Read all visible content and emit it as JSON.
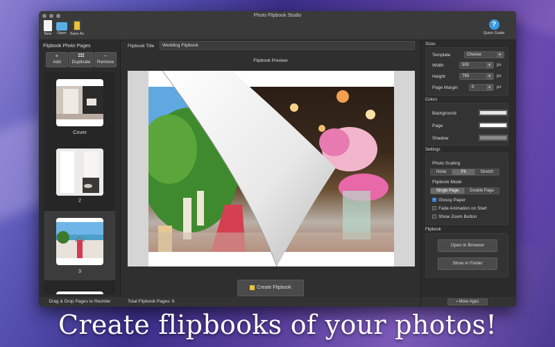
{
  "window": {
    "title": "Photo Flipbook Studio"
  },
  "toolbar": {
    "new_label": "New",
    "open_label": "Open",
    "save_as_label": "Save As",
    "quick_guide_label": "Quick Guide",
    "quick_guide_glyph": "?"
  },
  "left_panel": {
    "header": "Flipbook Photo Pages",
    "add_symbol": "+",
    "add_label": "Add",
    "duplicate_label": "Duplicate",
    "remove_symbol": "−",
    "remove_label": "Remove",
    "pages": [
      {
        "caption": "Cover"
      },
      {
        "caption": "2"
      },
      {
        "caption": "3"
      }
    ],
    "footer": "Drag & Drop Pages to Reorder"
  },
  "center": {
    "title_label": "Flipbook Title",
    "title_value": "Wedding Flipbook",
    "preview_label": "Flipbook Preview",
    "create_button": "Create Flipbook",
    "footer_label": "Total Flipbook Pages:",
    "footer_count": "6"
  },
  "sizes": {
    "section": "Sizes",
    "template_label": "Template",
    "template_value": "Choose",
    "width_label": "Width",
    "width_value": "500",
    "height_label": "Height",
    "height_value": "793",
    "margin_label": "Page Margin",
    "margin_value": "0",
    "unit": "px"
  },
  "colors": {
    "section": "Colors",
    "background_label": "Background",
    "background_color": "#e6e6e6",
    "page_label": "Page",
    "page_color": "#ffffff",
    "shadow_label": "Shadow",
    "shadow_color": "#8a8a8a"
  },
  "settings": {
    "section": "Settings",
    "scaling_label": "Photo Scaling",
    "scaling_options": [
      "None",
      "Fit",
      "Stretch"
    ],
    "scaling_selected": "Fit",
    "mode_label": "Flipbook Mode",
    "mode_options": [
      "Single Page",
      "Double Page"
    ],
    "mode_selected": "Single Page",
    "glossy_label": "Glossy Paper",
    "glossy_checked": true,
    "fade_label": "Fade Animation on Start",
    "fade_checked": false,
    "zoom_label": "Show Zoom Button",
    "zoom_checked": false
  },
  "flipbook": {
    "section": "Flipbook",
    "open_browser": "Open in Browser",
    "show_finder": "Show in Finder"
  },
  "more_apps": "More Apps",
  "tagline": "Create flipbooks of your photos!"
}
